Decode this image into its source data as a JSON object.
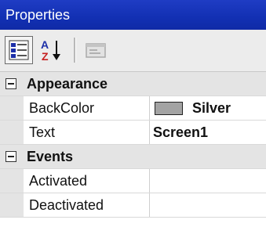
{
  "titlebar": {
    "title": "Properties"
  },
  "toolbar": {
    "buttons": [
      {
        "name": "categorized",
        "icon": "categorized-list-icon",
        "active": true
      },
      {
        "name": "alphabetical",
        "icon": "sort-az-icon",
        "active": false
      },
      {
        "name": "property-pages",
        "icon": "property-pages-icon",
        "enabled": false
      }
    ]
  },
  "grid": {
    "categories": [
      {
        "label": "Appearance",
        "expanded": true,
        "properties": [
          {
            "name": "BackColor",
            "value": "Silver",
            "swatch_color": "#a3a3a3"
          },
          {
            "name": "Text",
            "value": "Screen1"
          }
        ]
      },
      {
        "label": "Events",
        "expanded": true,
        "properties": [
          {
            "name": "Activated",
            "value": ""
          },
          {
            "name": "Deactivated",
            "value": ""
          }
        ]
      }
    ]
  },
  "colors": {
    "titlebar": "#1230b3",
    "category_bg": "#e4e4e4"
  }
}
